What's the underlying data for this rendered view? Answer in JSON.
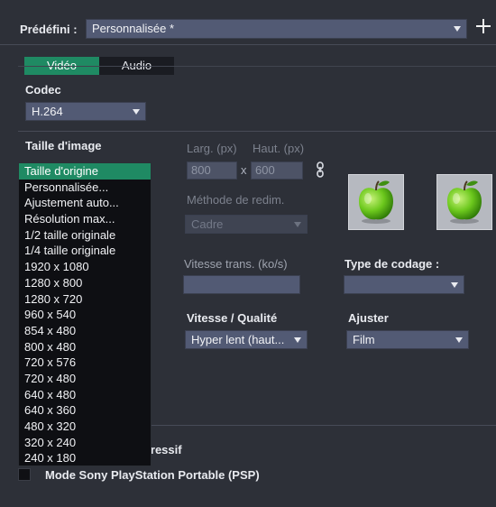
{
  "preset": {
    "label": "Prédéfini :",
    "value": "Personnalisée *"
  },
  "tabs": [
    {
      "label": "Vidéo"
    },
    {
      "label": "Audio"
    }
  ],
  "codec": {
    "label": "Codec",
    "value": "H.264"
  },
  "frame_size": {
    "label": "Taille d'image",
    "options": [
      "Taille d'origine",
      "Personnalisée...",
      "Ajustement auto...",
      "Résolution max...",
      "1/2 taille originale",
      "1/4 taille originale",
      "1920 x 1080",
      "1280 x 800",
      "1280 x 720",
      "960 x 540",
      "854 x 480",
      "800 x 480",
      "720 x 576",
      "720 x 480",
      "640 x 480",
      "640 x 360",
      "480 x 320",
      "320 x 240",
      "240 x 180"
    ],
    "selected": "Taille d'origine"
  },
  "dimensions": {
    "width_label": "Larg. (px)",
    "height_label": "Haut. (px)",
    "width_value": "800",
    "separator": "x",
    "height_value": "600"
  },
  "resize_method": {
    "label": "Méthode de redim.",
    "value": "Cadre"
  },
  "bitrate": {
    "label": "Vitesse trans. (ko/s)",
    "value": ""
  },
  "encoding_type": {
    "label": "Type de codage :",
    "value": ""
  },
  "speed_quality": {
    "label": "Vitesse / Qualité",
    "value": "Hyper lent (haut..."
  },
  "tune": {
    "label": "Ajuster",
    "value": "Film"
  },
  "progressive": {
    "label": "ogressif"
  },
  "psp": {
    "label": "Mode Sony PlayStation Portable (PSP)"
  },
  "icons": {
    "add": "plus-icon",
    "link": "chain-link-icon",
    "preview": "green-apple-icon"
  },
  "colors": {
    "accent": "#1f8a63",
    "background": "#2d3038",
    "dropdown": "#525a74"
  }
}
